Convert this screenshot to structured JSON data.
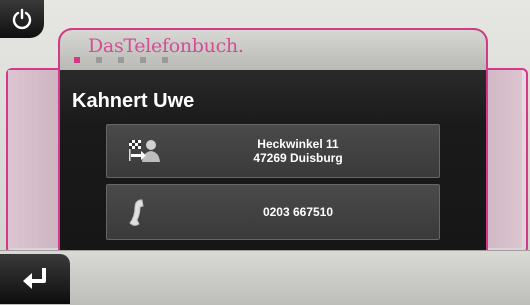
{
  "brand": {
    "name": "DasTelefonbuch."
  },
  "pager": {
    "count": 5,
    "active": 0
  },
  "contact": {
    "name": "Kahnert Uwe",
    "address_line1": "Heckwinkel 11",
    "address_line2": "47269 Duisburg",
    "phone": "0203 667510"
  },
  "icons": {
    "power": "power-icon",
    "address": "navigate-to-address-icon",
    "phone": "phone-handset-icon",
    "back": "back-arrow-icon"
  },
  "colors": {
    "accent": "#d4388a",
    "panel": "#1c1c1c",
    "text": "#ffffff"
  }
}
